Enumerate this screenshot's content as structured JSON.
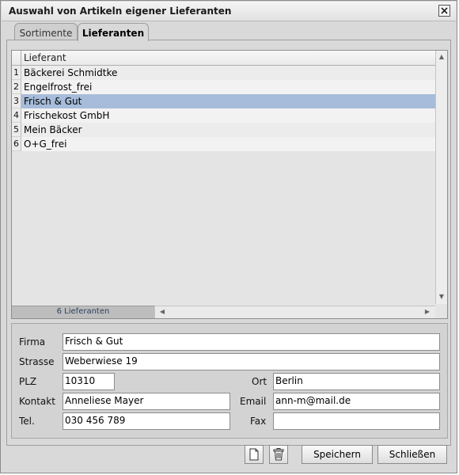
{
  "window": {
    "title": "Auswahl von Artikeln eigener Lieferanten"
  },
  "tabs": [
    {
      "label": "Sortimente",
      "active": false
    },
    {
      "label": "Lieferanten",
      "active": true
    }
  ],
  "list": {
    "column_header": "Lieferant",
    "rows": [
      {
        "num": "1",
        "name": "Bäckerei Schmidtke",
        "selected": false
      },
      {
        "num": "2",
        "name": "Engelfrost_frei",
        "selected": false
      },
      {
        "num": "3",
        "name": "Frisch & Gut",
        "selected": true
      },
      {
        "num": "4",
        "name": "Frischekost GmbH",
        "selected": false
      },
      {
        "num": "5",
        "name": "Mein Bäcker",
        "selected": false
      },
      {
        "num": "6",
        "name": "O+G_frei",
        "selected": false
      }
    ],
    "footer": "6 Lieferanten"
  },
  "form": {
    "firma": {
      "label": "Firma",
      "value": "Frisch & Gut"
    },
    "strasse": {
      "label": "Strasse",
      "value": "Weberwiese 19"
    },
    "plz": {
      "label": "PLZ",
      "value": "10310"
    },
    "ort": {
      "label": "Ort",
      "value": "Berlin"
    },
    "kontakt": {
      "label": "Kontakt",
      "value": "Anneliese Mayer"
    },
    "email": {
      "label": "Email",
      "value": "ann-m@mail.de"
    },
    "tel": {
      "label": "Tel.",
      "value": "030 456 789"
    },
    "fax": {
      "label": "Fax",
      "value": ""
    }
  },
  "buttons": {
    "new_icon": "new-document-icon",
    "delete_icon": "trash-icon",
    "save": "Speichern",
    "close": "Schließen"
  },
  "colors": {
    "selection": "#a6bcda",
    "background": "#d9d9d9"
  }
}
